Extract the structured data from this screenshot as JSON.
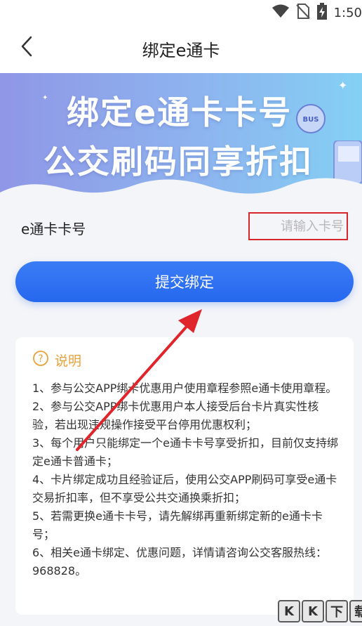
{
  "status_bar": {
    "time": "1:50",
    "icons": [
      "wifi-icon",
      "no-sim-icon",
      "battery-charging-icon"
    ]
  },
  "nav": {
    "back_icon": "chevron-left-icon",
    "title": "绑定e通卡"
  },
  "banner": {
    "line1": "绑定e通卡卡号",
    "line2": "公交刷码同享折扣",
    "bus_badge": "BUS"
  },
  "form": {
    "label": "e通卡卡号",
    "placeholder": "请输入卡号",
    "value": "",
    "submit_label": "提交绑定",
    "highlight_color": "#d8262d"
  },
  "info": {
    "icon": "question-circle-icon",
    "title": "说明",
    "items": [
      "1、参与公交APP绑卡优惠用户使用章程参照e通卡使用章程。",
      "2、参与公交APP绑卡优惠用户本人接受后台卡片真实性核验，若出现违规操作接受平台停用优惠权利；",
      "3、每个用户只能绑定一个e通卡卡号享受折扣，目前仅支持绑定e通卡普通卡；",
      "4、卡片绑定成功且经验证后，使用公交APP刷码可享受e通卡交易折扣率，但不享受公共交通换乘折扣；",
      "5、若需更换e通卡卡号，请先解绑再重新绑定新的e通卡卡号；",
      "6、相关e通卡绑定、优惠问题，详情请咨询公交客服热线：968828。"
    ]
  },
  "annotation": {
    "arrow_color": "#e0242b"
  },
  "watermark": {
    "chars": [
      "K",
      "K",
      "下",
      "载"
    ]
  },
  "colors": {
    "primary": "#2a6df0",
    "accent_orange": "#e9a13a",
    "background": "#f4f5f9"
  }
}
